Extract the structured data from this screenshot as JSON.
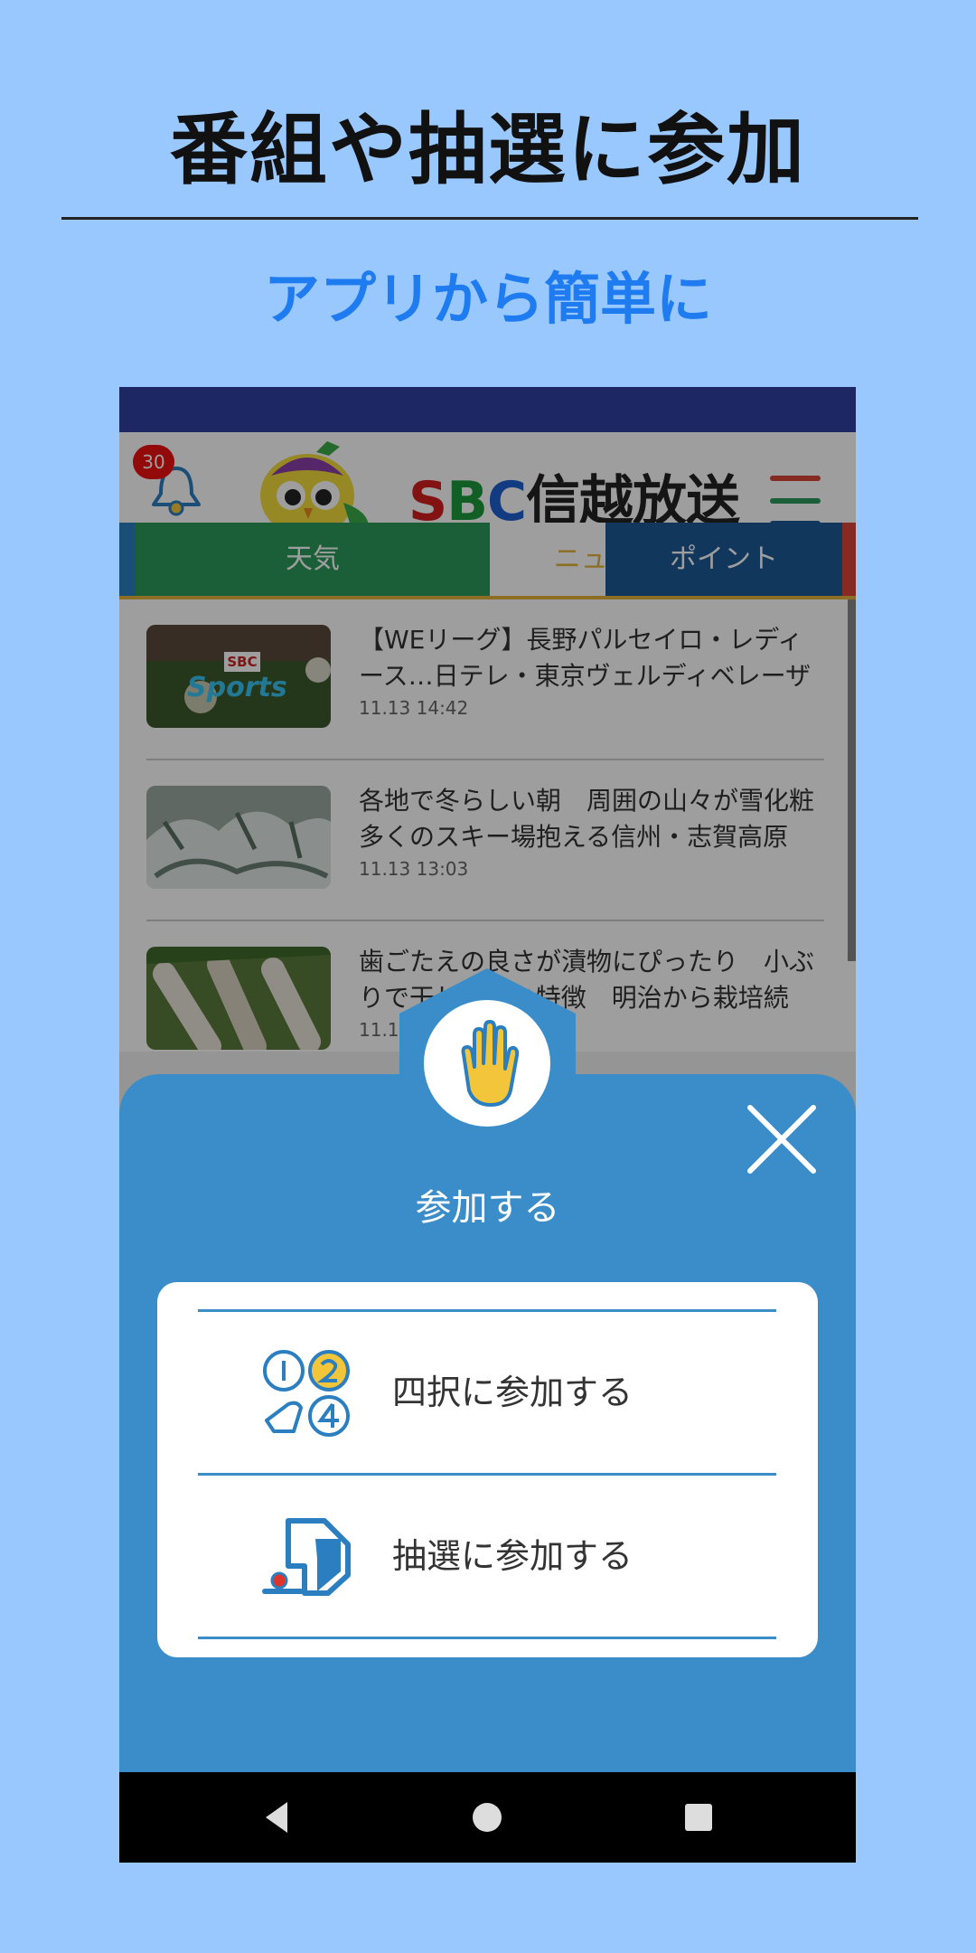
{
  "promo": {
    "headline": "番組や抽選に参加",
    "subline": "アプリから簡単に"
  },
  "app": {
    "notification_count": "30",
    "logo": {
      "s": "S",
      "b": "B",
      "c": "C",
      "name": "信越放送"
    },
    "tabs": [
      {
        "label": "天気",
        "color": "#2d9a5b"
      },
      {
        "label": "ニュース",
        "color": "#e3b43c",
        "active": true
      },
      {
        "label": "ポイント",
        "color": "#1e5a96"
      }
    ],
    "news": [
      {
        "title": "【WEリーグ】長野パルセイロ・レディース…日テレ・東京ヴェルディベレーザに…",
        "date": "11.13 14:42",
        "thumb": "sports"
      },
      {
        "title": "各地で冬らしい朝　周囲の山々が雪化粧　多くのスキー場抱える信州・志賀高原に…",
        "date": "11.13 13:03",
        "thumb": "snow"
      },
      {
        "title": "歯ごたえの良さが漬物にぴったり　小ぶりで干しやすい特徴　明治から栽培続く…",
        "date": "11.1",
        "thumb": "radish"
      }
    ],
    "thumb_text": {
      "brand": "SBC",
      "sports": "Sports"
    }
  },
  "sheet": {
    "title": "参加する",
    "options": [
      {
        "label": "四択に参加する",
        "icon": "quiz-choice-icon"
      },
      {
        "label": "抽選に参加する",
        "icon": "lottery-icon"
      }
    ]
  },
  "colors": {
    "accent": "#3a8dc8",
    "background": "#99c8ff",
    "status_bar": "#2e3fa0",
    "yellow": "#f3c53a"
  }
}
